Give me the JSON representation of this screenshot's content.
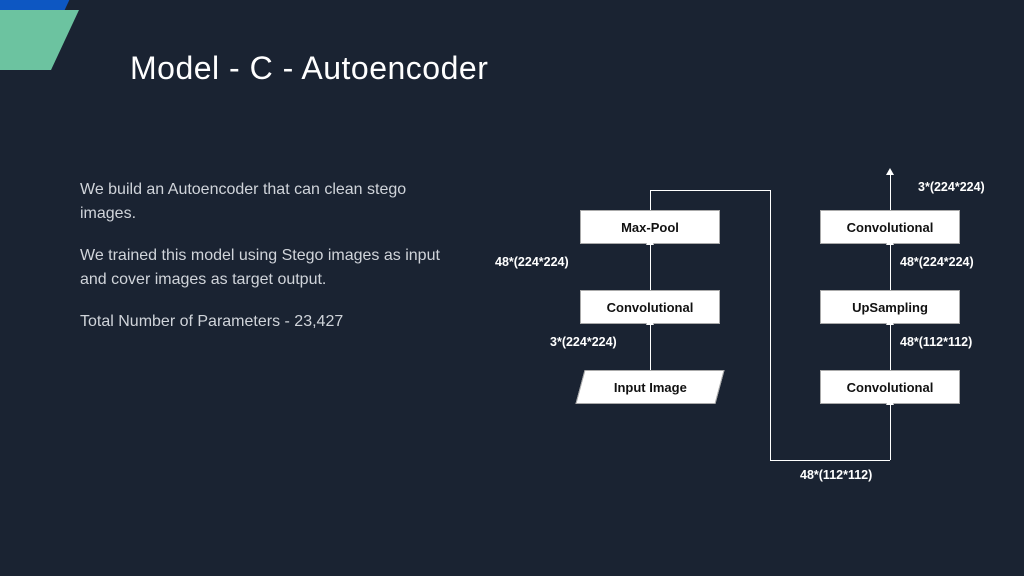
{
  "title": "Model - C - Autoencoder",
  "paragraphs": {
    "p1": "We build an Autoencoder that can clean stego images.",
    "p2": "We trained this model using Stego images as input and cover images as target output.",
    "p3": "Total Number of Parameters - 23,427"
  },
  "diagram": {
    "left_col": {
      "n0": "Max-Pool",
      "n1": "Convolutional",
      "n2": "Input Image",
      "d0": "48*(224*224)",
      "d1": "3*(224*224)"
    },
    "right_col": {
      "n0": "Convolutional",
      "n1": "UpSampling",
      "n2": "Convolutional",
      "d_top": "3*(224*224)",
      "d0": "48*(224*224)",
      "d1": "48*(112*112)"
    },
    "u_label": "48*(112*112)"
  }
}
